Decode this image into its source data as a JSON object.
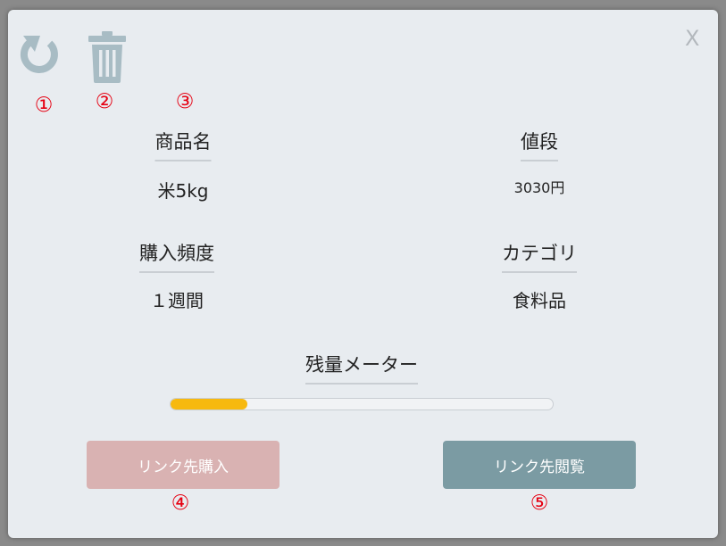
{
  "dialog": {
    "close_label": "X"
  },
  "toolbar": {
    "refresh_icon": "refresh-icon",
    "trash_icon": "trash-icon",
    "icon_color": "#a8bcc4"
  },
  "annotations": {
    "n1": "①",
    "n2": "②",
    "n3": "③",
    "n4": "④",
    "n5": "⑤",
    "color": "#e60012"
  },
  "product": {
    "name_label": "商品名",
    "name_value": "米5kg",
    "price_label": "値段",
    "price_value": "3030円",
    "frequency_label": "購入頻度",
    "frequency_value": "１週間",
    "category_label": "カテゴリ",
    "category_value": "食料品"
  },
  "meter": {
    "label": "残量メーター",
    "level": 0.2,
    "fill_color": "#f7b90f"
  },
  "buttons": {
    "buy_label": "リンク先購入",
    "view_label": "リンク先閲覧",
    "buy_color": "#d9b2b2",
    "view_color": "#7b9ba3"
  }
}
